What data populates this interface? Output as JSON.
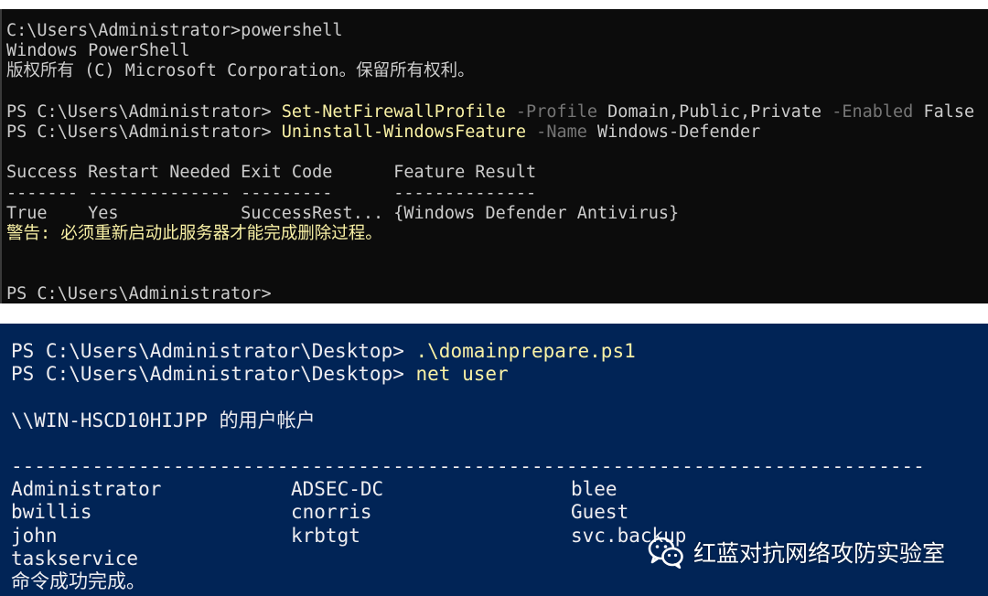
{
  "cmd_window": {
    "line1": "C:\\Users\\Administrator>powershell",
    "line2": "Windows PowerShell",
    "line3": "版权所有 (C) Microsoft Corporation。保留所有权利。",
    "prompt": "PS C:\\Users\\Administrator> ",
    "cmd1": {
      "cmdlet": "Set-NetFirewallProfile",
      "param1": " -Profile ",
      "arg1": "Domain,Public,Private",
      "param2": " -Enabled ",
      "arg2": "False"
    },
    "cmd2": {
      "cmdlet": "Uninstall-WindowsFeature",
      "param1": " -Name ",
      "arg1": "Windows-Defender"
    },
    "table_header": "Success Restart Needed Exit Code      Feature Result",
    "table_rule": "------- -------------- ---------      --------------",
    "table_row": "True    Yes            SuccessRest... {Windows Defender Antivirus}",
    "warning": "警告: 必须重新启动此服务器才能完成删除过程。",
    "final_prompt": "PS C:\\Users\\Administrator>"
  },
  "ps_window": {
    "prompt": "PS C:\\Users\\Administrator\\Desktop> ",
    "cmd1": ".\\domainprepare.ps1",
    "cmd2": "net user",
    "accounts_header": "\\\\WIN-HSCD10HIJPP 的用户帐户",
    "rule": "-------------------------------------------------------------------------------",
    "users": [
      [
        "Administrator",
        "ADSEC-DC",
        "blee"
      ],
      [
        "bwillis",
        "cnorris",
        "Guest"
      ],
      [
        "john",
        "krbtgt",
        "svc.backup"
      ],
      [
        "taskservice",
        "",
        ""
      ]
    ],
    "done": "命令成功完成。"
  },
  "watermark": {
    "icon": "wechat-icon",
    "text": "红蓝对抗网络攻防实验室"
  },
  "colors": {
    "cmd_bg": "#0c0c0c",
    "ps_bg": "#012456",
    "cmdlet_yellow": "#f9f1a5",
    "param_gray": "#767676"
  }
}
